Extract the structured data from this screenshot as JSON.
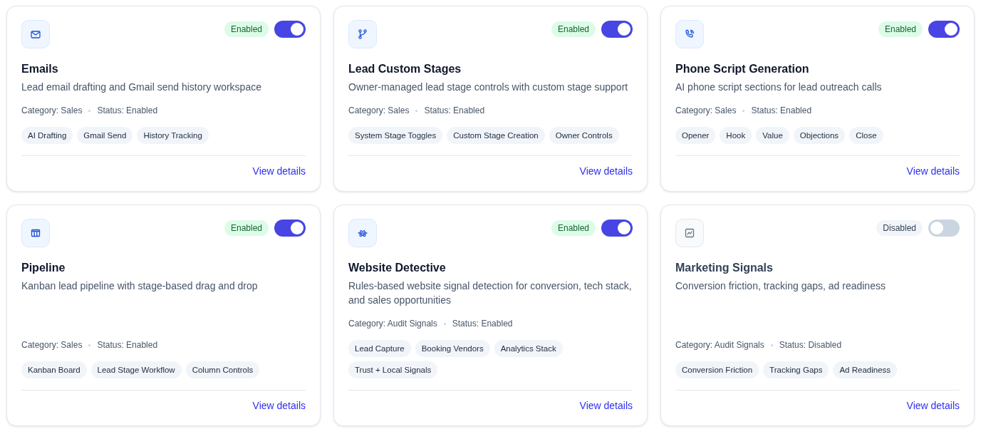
{
  "cards": [
    {
      "badge": "Enabled",
      "enabled": true,
      "title": "Emails",
      "description": "Lead email drafting and Gmail send history workspace",
      "category": "Category: Sales",
      "status": "Status: Enabled",
      "tags": [
        "AI Drafting",
        "Gmail Send",
        "History Tracking"
      ],
      "link": "View details"
    },
    {
      "badge": "Enabled",
      "enabled": true,
      "title": "Lead Custom Stages",
      "description": "Owner-managed lead stage controls with custom stage support",
      "category": "Category: Sales",
      "status": "Status: Enabled",
      "tags": [
        "System Stage Toggles",
        "Custom Stage Creation",
        "Owner Controls"
      ],
      "link": "View details"
    },
    {
      "badge": "Enabled",
      "enabled": true,
      "title": "Phone Script Generation",
      "description": "AI phone script sections for lead outreach calls",
      "category": "Category: Sales",
      "status": "Status: Enabled",
      "tags": [
        "Opener",
        "Hook",
        "Value",
        "Objections",
        "Close"
      ],
      "link": "View details"
    },
    {
      "badge": "Enabled",
      "enabled": true,
      "title": "Pipeline",
      "description": "Kanban lead pipeline with stage-based drag and drop",
      "category": "Category: Sales",
      "status": "Status: Enabled",
      "tags": [
        "Kanban Board",
        "Lead Stage Workflow",
        "Column Controls"
      ],
      "link": "View details"
    },
    {
      "badge": "Enabled",
      "enabled": true,
      "title": "Website Detective",
      "description": "Rules-based website signal detection for conversion, tech stack, and sales opportunities",
      "category": "Category: Audit Signals",
      "status": "Status: Enabled",
      "tags": [
        "Lead Capture",
        "Booking Vendors",
        "Analytics Stack",
        "Trust + Local Signals"
      ],
      "link": "View details"
    },
    {
      "badge": "Disabled",
      "enabled": false,
      "title": "Marketing Signals",
      "description": "Conversion friction, tracking gaps, ad readiness",
      "category": "Category: Audit Signals",
      "status": "Status: Disabled",
      "tags": [
        "Conversion Friction",
        "Tracking Gaps",
        "Ad Readiness"
      ],
      "link": "View details"
    }
  ]
}
